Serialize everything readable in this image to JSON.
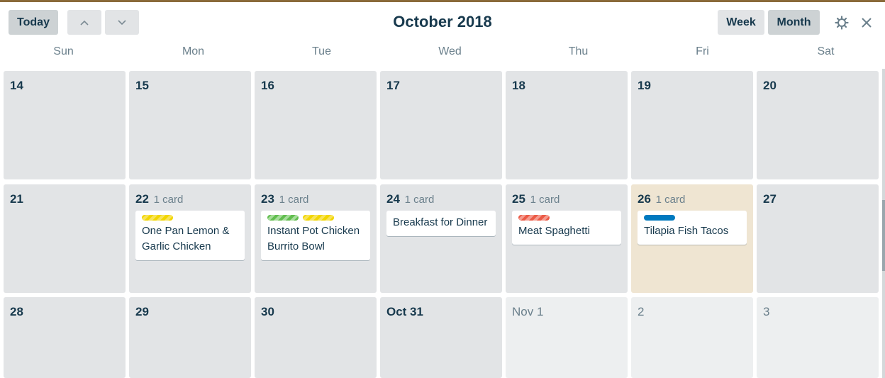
{
  "header": {
    "today_label": "Today",
    "prev_icon": "chevron-up-icon",
    "next_icon": "chevron-down-icon",
    "title": "October 2018",
    "week_label": "Week",
    "month_label": "Month",
    "settings_icon": "gear-icon",
    "close_icon": "close-icon"
  },
  "weekdays": [
    "Sun",
    "Mon",
    "Tue",
    "Wed",
    "Thu",
    "Fri",
    "Sat"
  ],
  "weeks": [
    [
      {
        "day": "14"
      },
      {
        "day": "15"
      },
      {
        "day": "16"
      },
      {
        "day": "17"
      },
      {
        "day": "18"
      },
      {
        "day": "19"
      },
      {
        "day": "20"
      }
    ],
    [
      {
        "day": "21"
      },
      {
        "day": "22",
        "count": "1 card",
        "card": {
          "title": "One Pan Lemon & Garlic Chicken",
          "labels": [
            "yellow"
          ]
        }
      },
      {
        "day": "23",
        "count": "1 card",
        "card": {
          "title": "Instant Pot Chicken Burrito Bowl",
          "labels": [
            "green",
            "yellow"
          ]
        }
      },
      {
        "day": "24",
        "count": "1 card",
        "card": {
          "title": "Breakfast for Dinner",
          "labels": []
        }
      },
      {
        "day": "25",
        "count": "1 card",
        "card": {
          "title": "Meat Spaghetti",
          "labels": [
            "red"
          ]
        }
      },
      {
        "day": "26",
        "count": "1 card",
        "today": true,
        "card": {
          "title": "Tilapia Fish Tacos",
          "labels": [
            "blue"
          ]
        }
      },
      {
        "day": "27"
      }
    ],
    [
      {
        "day": "28"
      },
      {
        "day": "29"
      },
      {
        "day": "30"
      },
      {
        "day": "Oct 31"
      },
      {
        "day": "Nov 1",
        "other": true
      },
      {
        "day": "2",
        "other": true
      },
      {
        "day": "3",
        "other": true
      }
    ]
  ],
  "colors": {
    "label_yellow": "#f2d600",
    "label_green": "#61bd4f",
    "label_red": "#eb5a46",
    "label_blue": "#0079bf",
    "today_bg": "#efe5d2"
  }
}
